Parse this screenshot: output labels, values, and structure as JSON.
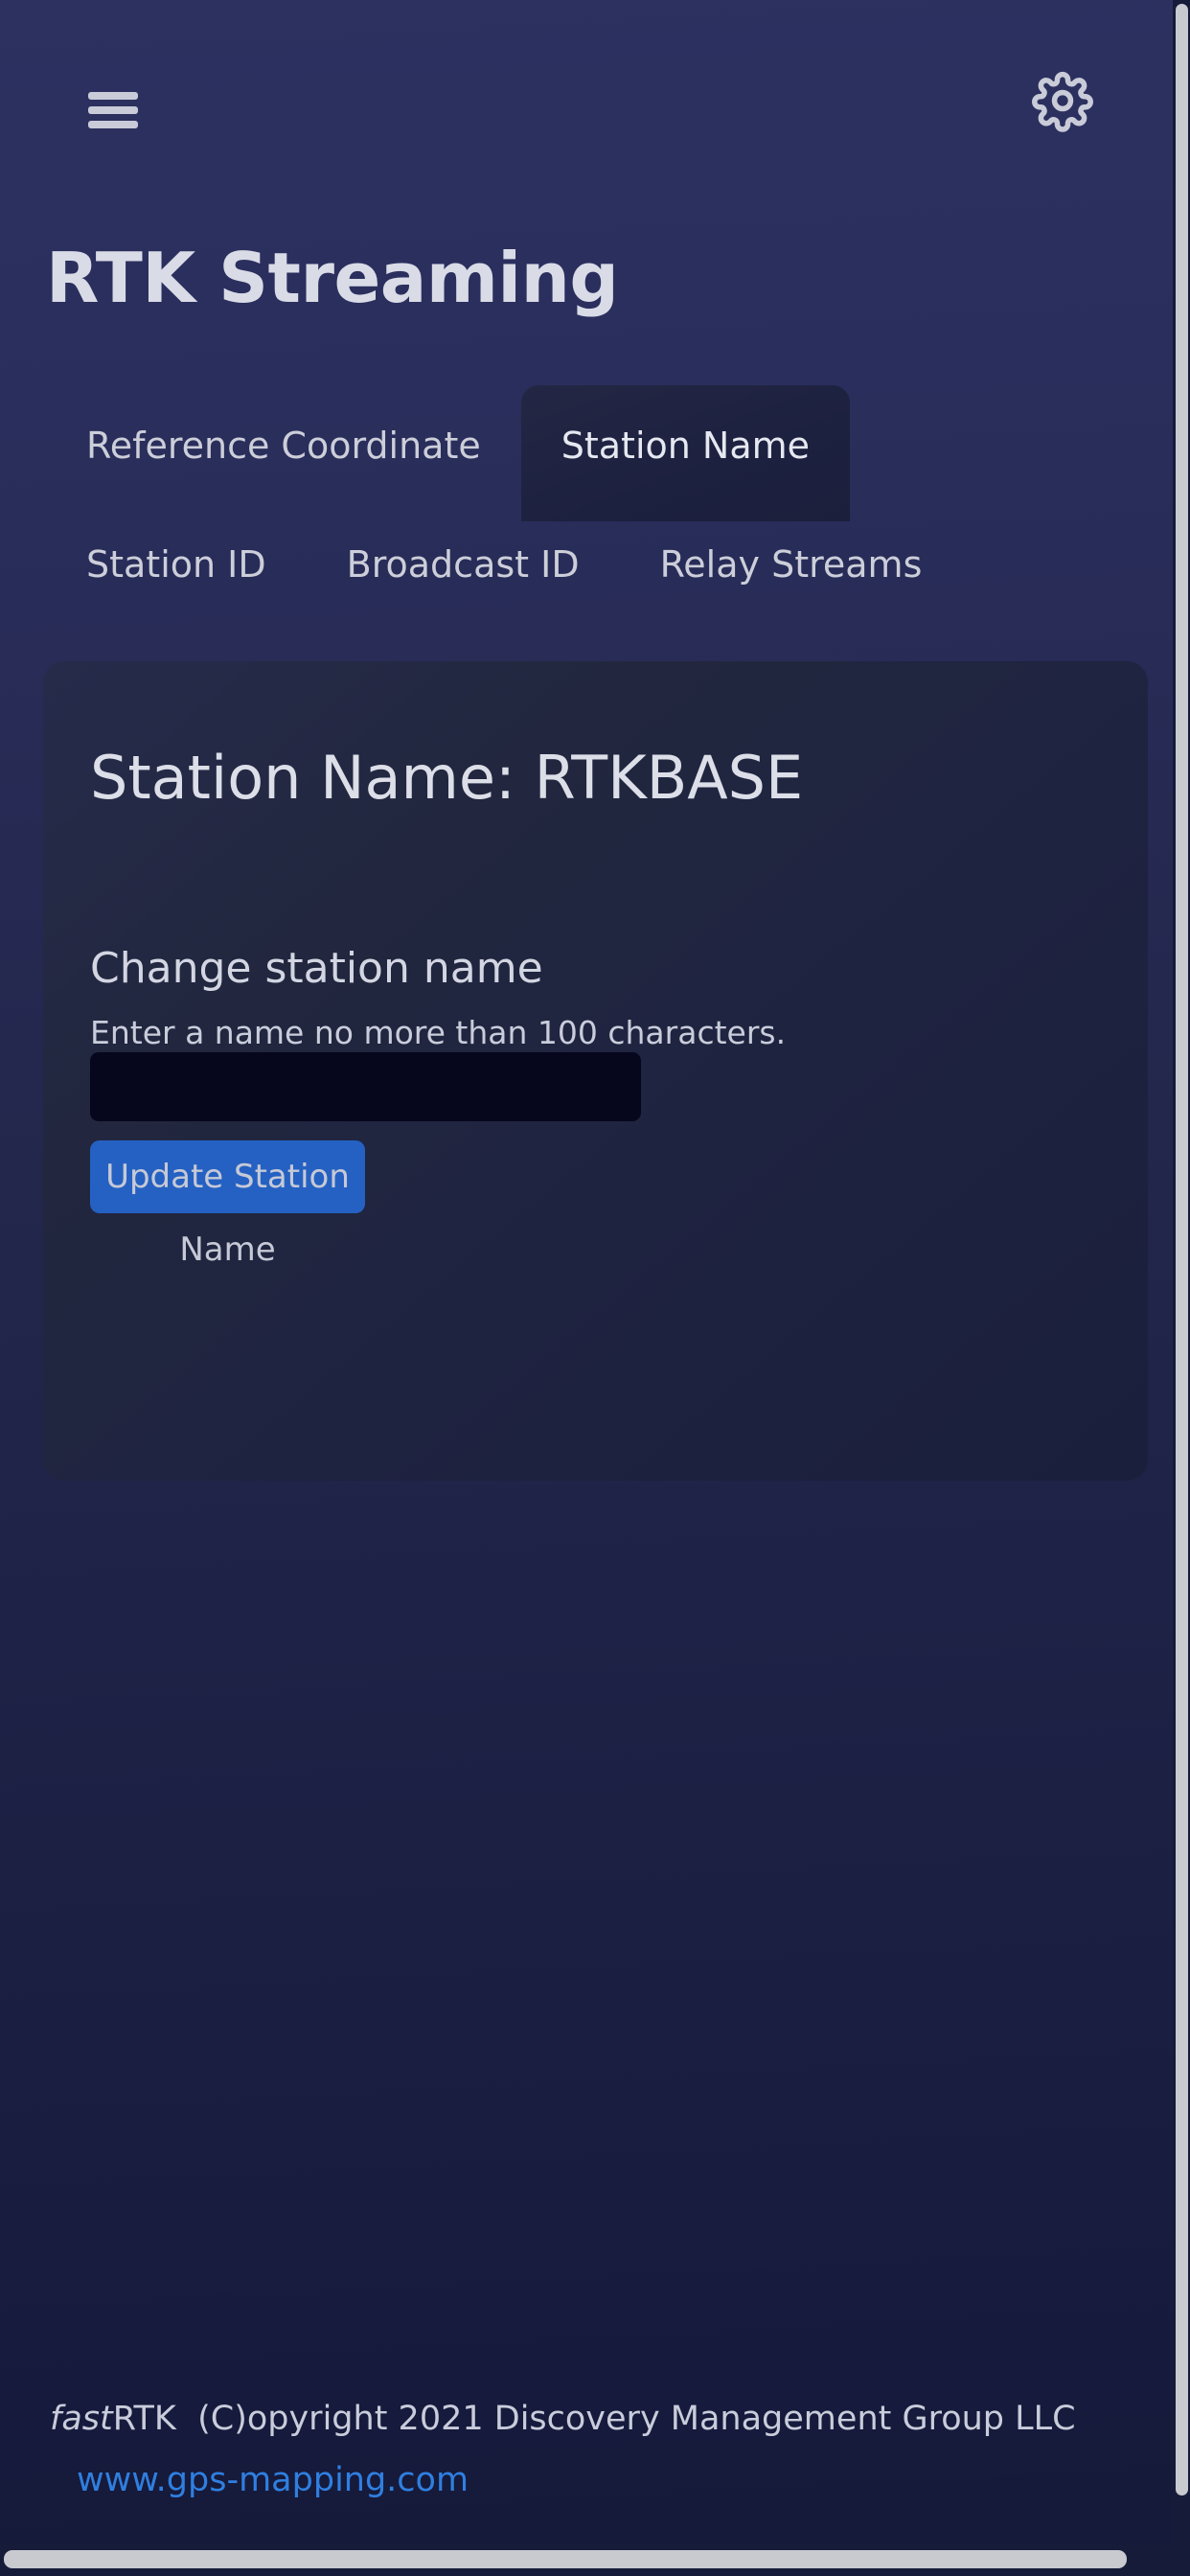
{
  "app": {
    "title": "RTK Streaming",
    "menu_icon": "hamburger-menu-icon",
    "settings_icon": "gear-icon"
  },
  "tabs": [
    {
      "label": "Reference Coordinate",
      "active": false
    },
    {
      "label": "Station Name",
      "active": true
    },
    {
      "label": "Station ID",
      "active": false
    },
    {
      "label": "Broadcast ID",
      "active": false
    },
    {
      "label": "Relay Streams",
      "active": false
    }
  ],
  "card": {
    "title": "Station Name: RTKBASE",
    "station_name_value": "RTKBASE",
    "section_label": "Change station name",
    "helper_text": "Enter a name no more than 100 characters.",
    "input_value": "",
    "input_placeholder": "",
    "button_label": "Update Station Name"
  },
  "footer": {
    "brand_italic": "fast",
    "brand_rest": "RTK",
    "copyright": "  (C)opyright 2021 Discovery Management Group LLC",
    "link": "www.gps-mapping.com"
  },
  "colors": {
    "accent_button": "#2561c2",
    "link": "#2f7fe0",
    "bg_top": "#2d3160",
    "bg_bottom": "#151939",
    "card_bg": "#22273f",
    "input_bg": "#06061c",
    "text": "#d6d8e4"
  }
}
